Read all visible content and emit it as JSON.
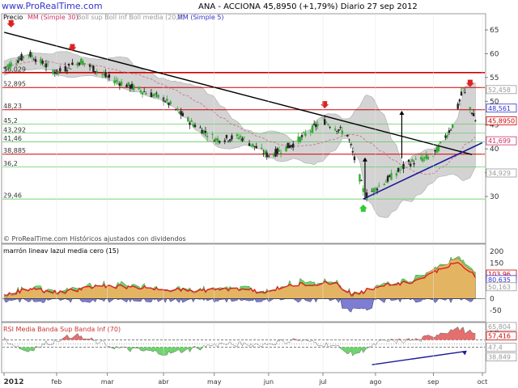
{
  "header": {
    "site": "www.ProRealTime.com",
    "title": "ANA - ACCIONA   45,8950 (+1,79%)   Diario  27 sep 2012"
  },
  "price_panel": {
    "legend_label": "Precio",
    "legend_items": [
      {
        "text": "MM (Simple 30)",
        "color": "#cc3366"
      },
      {
        "text": "Boll sup Boll inf Boll media (20,2)",
        "color": "#999999"
      },
      {
        "text": "MM (Simple 5)",
        "color": "#3333cc"
      }
    ],
    "footer": "© ProRealTime.com Históricos ajustados con dividendos",
    "right_ticks": [
      {
        "label": "65",
        "value": 65
      },
      {
        "label": "60",
        "value": 60
      },
      {
        "label": "55",
        "value": 55
      },
      {
        "label": "50",
        "value": 50
      },
      {
        "label": "45",
        "value": 45
      },
      {
        "label": "40",
        "value": 40
      },
      {
        "label": "35",
        "value": 35
      },
      {
        "label": "30",
        "value": 30
      }
    ],
    "right_badges": [
      {
        "label": "52,458",
        "value": 52.458,
        "color": "#999999"
      },
      {
        "label": "48,561",
        "value": 48.561,
        "color": "#3333cc"
      },
      {
        "label": "45,8950",
        "value": 45.895,
        "color": "#cc0000"
      },
      {
        "label": "41,699",
        "value": 41.699,
        "color": "#cc3366"
      },
      {
        "label": "34,929",
        "value": 34.929,
        "color": "#999999"
      }
    ],
    "left_levels": [
      {
        "label": "56,029",
        "value": 56.029,
        "color": "#cc0000"
      },
      {
        "label": "52,895",
        "value": 52.895,
        "color": "#cc0000"
      },
      {
        "label": "48,23",
        "value": 48.23,
        "color": "#cc0000"
      },
      {
        "label": "45,2",
        "value": 45.2,
        "color": "#33aa33"
      },
      {
        "label": "43,292",
        "value": 43.292,
        "color": "#33aa33"
      },
      {
        "label": "41,46",
        "value": 41.46,
        "color": "#33aa33"
      },
      {
        "label": "38,885",
        "value": 38.885,
        "color": "#cc0000"
      },
      {
        "label": "36,2",
        "value": 36.2,
        "color": "#33aa33"
      },
      {
        "label": "29,46",
        "value": 29.46,
        "color": "#33aa33"
      }
    ]
  },
  "macd_panel": {
    "legend": "marrón lineav lazul media cero (15)",
    "right_ticks": [
      {
        "label": "200",
        "value": 200
      },
      {
        "label": "150",
        "value": 150
      },
      {
        "label": "100",
        "value": 100
      },
      {
        "label": "50",
        "value": 50
      },
      {
        "label": "0",
        "value": 0
      },
      {
        "label": "-50",
        "value": -50
      }
    ],
    "right_badges": [
      {
        "label": "103,96",
        "value": 103.96,
        "color": "#cc0000"
      },
      {
        "label": "80,635",
        "value": 80.635,
        "color": "#3333cc"
      },
      {
        "label": "50,163",
        "value": 50.163,
        "color": "#999999"
      }
    ]
  },
  "rsi_panel": {
    "legend": "RSI Media Banda Sup Banda Inf (70)",
    "right_ticks": [
      {
        "label": "60",
        "value": 60
      },
      {
        "label": "40",
        "value": 40
      }
    ],
    "right_badges": [
      {
        "label": "65,804",
        "value": 65.804,
        "color": "#999999"
      },
      {
        "label": "57,416",
        "value": 57.416,
        "color": "#cc0000"
      },
      {
        "label": "47,4",
        "value": 47.4,
        "color": "#999999"
      },
      {
        "label": "38,849",
        "value": 38.849,
        "color": "#999999"
      }
    ]
  },
  "x_axis": {
    "labels": [
      "2012",
      "feb",
      "mar",
      "abr",
      "may",
      "jun",
      "jul",
      "ago",
      "sep",
      "oct"
    ]
  },
  "colors": {
    "up_candle": "#33aa33",
    "down_candle": "#222222",
    "bollinger_fill": "#c8c8c8",
    "resistance": "#cc0000",
    "support": "#66cc66",
    "trend_down": "#000000",
    "trend_up": "#1a1a99",
    "macd_orange": "#f0b060",
    "macd_green": "#55cc55",
    "macd_blue": "#6666cc",
    "rsi_red": "#e05555",
    "rsi_green": "#55cc55"
  },
  "chart_data": {
    "type": "line",
    "series": [
      {
        "name": "Precio",
        "x": [
          "2012-01-02",
          "2012-01-16",
          "2012-02-01",
          "2012-02-15",
          "2012-03-01",
          "2012-03-15",
          "2012-04-02",
          "2012-04-16",
          "2012-05-02",
          "2012-05-16",
          "2012-06-01",
          "2012-06-15",
          "2012-07-02",
          "2012-07-16",
          "2012-07-26",
          "2012-08-06",
          "2012-08-20",
          "2012-09-03",
          "2012-09-14",
          "2012-09-20",
          "2012-09-27"
        ],
        "values": [
          57,
          60,
          56,
          58.5,
          55,
          53,
          50.5,
          46,
          42,
          42.5,
          38.5,
          41,
          46,
          43,
          30,
          33,
          37,
          38.5,
          45,
          52.5,
          45.895
        ]
      }
    ],
    "ylim": [
      27,
      68
    ],
    "annotations": {
      "resistance_levels": [
        56.029,
        52.895,
        48.23,
        38.885
      ],
      "support_levels": [
        45.2,
        43.292,
        41.46,
        36.2,
        29.46
      ]
    }
  }
}
